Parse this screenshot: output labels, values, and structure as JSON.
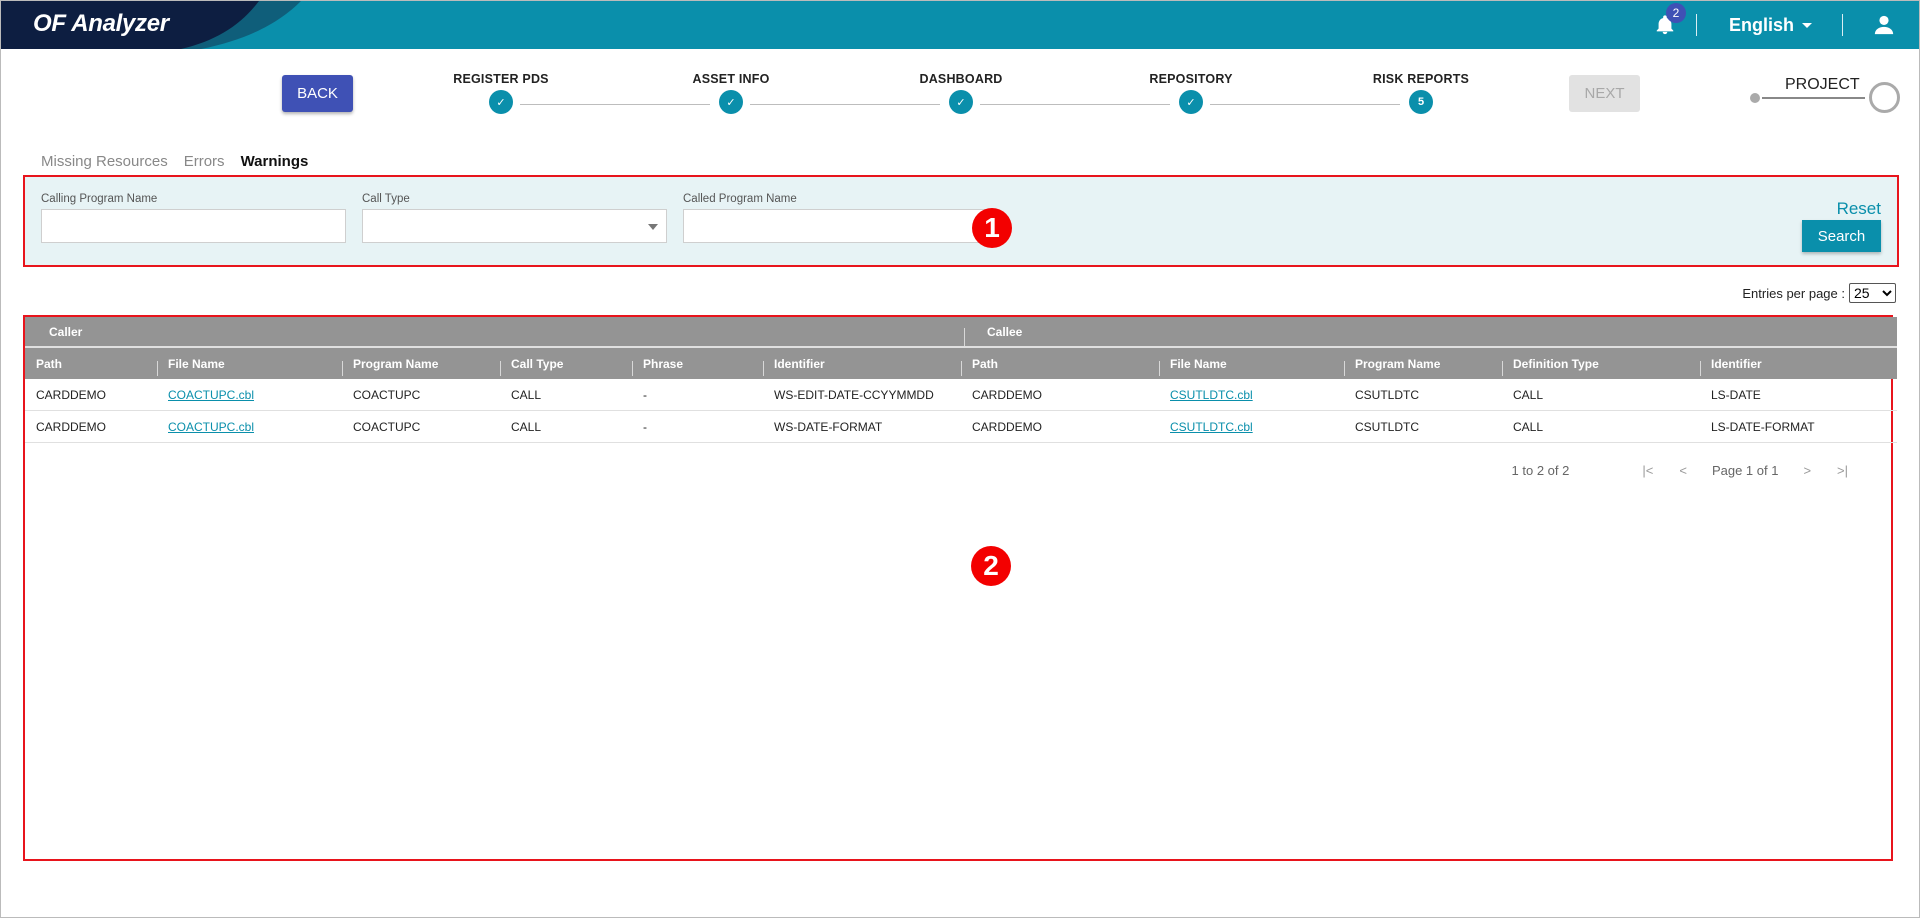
{
  "app": {
    "title": "OF Analyzer",
    "notifications_count": "2",
    "language": "English",
    "colors": {
      "primary": "#0a8fab",
      "brand_dark": "#0d1e41",
      "back_button": "#3f51b5",
      "marker": "#f30000"
    }
  },
  "stepper": {
    "back_label": "BACK",
    "next_label": "NEXT",
    "steps": [
      {
        "label": "REGISTER PDS",
        "state": "done",
        "marker": "✓"
      },
      {
        "label": "ASSET INFO",
        "state": "done",
        "marker": "✓"
      },
      {
        "label": "DASHBOARD",
        "state": "done",
        "marker": "✓"
      },
      {
        "label": "REPOSITORY",
        "state": "done",
        "marker": "✓"
      },
      {
        "label": "RISK REPORTS",
        "state": "current",
        "marker": "5"
      }
    ],
    "project_label": "PROJECT"
  },
  "tabs": [
    {
      "label": "Missing Resources",
      "active": false
    },
    {
      "label": "Errors",
      "active": false
    },
    {
      "label": "Warnings",
      "active": true
    }
  ],
  "filter": {
    "calling_program_label": "Calling Program Name",
    "calling_program_value": "",
    "call_type_label": "Call Type",
    "call_type_value": "",
    "called_program_label": "Called Program Name",
    "called_program_value": "",
    "reset_label": "Reset",
    "search_label": "Search"
  },
  "markers": {
    "one": "1",
    "two": "2"
  },
  "entries": {
    "label": "Entries per page :",
    "value": "25",
    "options": [
      "25"
    ]
  },
  "table": {
    "groups": {
      "caller": "Caller",
      "callee": "Callee"
    },
    "columns": [
      "Path",
      "File Name",
      "Program Name",
      "Call Type",
      "Phrase",
      "Identifier",
      "Path",
      "File Name",
      "Program Name",
      "Definition Type",
      "Identifier"
    ],
    "rows": [
      [
        "CARDDEMO",
        "COACTUPC.cbl",
        "COACTUPC",
        "CALL",
        "-",
        "WS-EDIT-DATE-CCYYMMDD",
        "CARDDEMO",
        "CSUTLDTC.cbl",
        "CSUTLDTC",
        "CALL",
        "LS-DATE"
      ],
      [
        "CARDDEMO",
        "COACTUPC.cbl",
        "COACTUPC",
        "CALL",
        "-",
        "WS-DATE-FORMAT",
        "CARDDEMO",
        "CSUTLDTC.cbl",
        "CSUTLDTC",
        "CALL",
        "LS-DATE-FORMAT"
      ]
    ]
  },
  "pager": {
    "count": "1 to 2 of 2",
    "page_info": "Page 1 of 1",
    "first": "|<",
    "prev": "<",
    "next": ">",
    "last": ">|"
  }
}
